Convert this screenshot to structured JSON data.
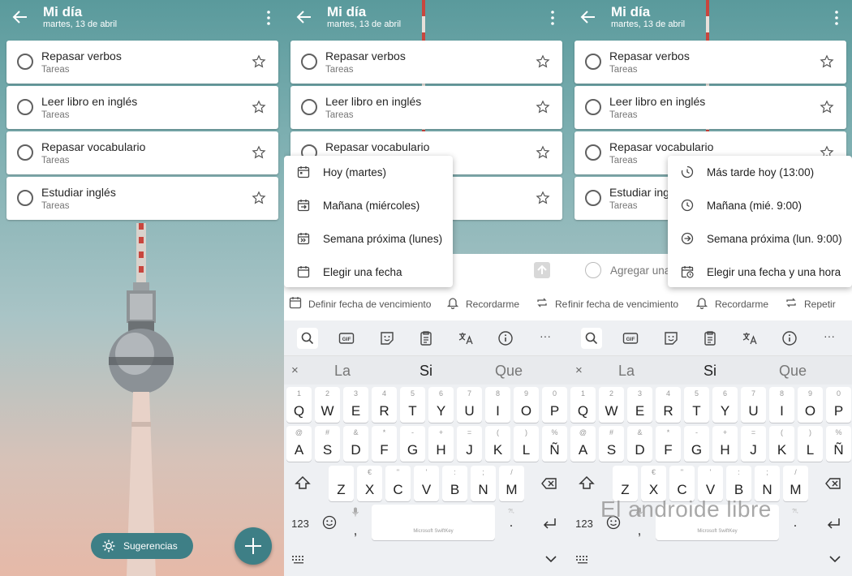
{
  "app": {
    "title": "Mi día",
    "subtitle": "martes, 13 de abril"
  },
  "tasks": [
    {
      "title": "Repasar verbos",
      "list": "Tareas"
    },
    {
      "title": "Leer libro en inglés",
      "list": "Tareas"
    },
    {
      "title": "Repasar vocabulario",
      "list": "Tareas"
    },
    {
      "title": "Estudiar inglés",
      "list": "Tareas"
    }
  ],
  "panel3_task4_visible": "Estudiar ing",
  "suggestions_button": "Sugerencias",
  "add_task_placeholder": "Agregar una",
  "options": {
    "due_date": "Definir fecha de vencimiento",
    "due_date_cut": "finir fecha de vencimiento",
    "repeat_cut": "Re",
    "remind": "Recordarme",
    "repeat": "Repetir"
  },
  "due_menu": [
    {
      "icon": "calendar-today-icon",
      "label": "Hoy (martes)"
    },
    {
      "icon": "calendar-tomorrow-icon",
      "label": "Mañana (miércoles)"
    },
    {
      "icon": "calendar-next-week-icon",
      "label": "Semana próxima (lunes)"
    },
    {
      "icon": "calendar-pick-icon",
      "label": "Elegir una fecha"
    }
  ],
  "remind_menu": [
    {
      "icon": "clock-later-icon",
      "label": "Más tarde hoy (13:00)"
    },
    {
      "icon": "clock-icon",
      "label": "Mañana (mié. 9:00)"
    },
    {
      "icon": "arrow-circle-icon",
      "label": "Semana próxima (lun. 9:00)"
    },
    {
      "icon": "calendar-clock-icon",
      "label": "Elegir una fecha y una hora"
    }
  ],
  "keyboard": {
    "toolbar_icons": [
      "search-icon",
      "gif-icon",
      "sticker-icon",
      "clipboard-icon",
      "translate-icon",
      "info-icon",
      "more-icon"
    ],
    "gif_label": "GIF",
    "more_label": "···",
    "suggestions": [
      "La",
      "Si",
      "Que"
    ],
    "close_label": "×",
    "row1": [
      [
        "Q",
        "1"
      ],
      [
        "W",
        "2"
      ],
      [
        "E",
        "3"
      ],
      [
        "R",
        "4"
      ],
      [
        "T",
        "5"
      ],
      [
        "Y",
        "6"
      ],
      [
        "U",
        "7"
      ],
      [
        "I",
        "8"
      ],
      [
        "O",
        "9"
      ],
      [
        "P",
        "0"
      ]
    ],
    "row2": [
      [
        "A",
        "@"
      ],
      [
        "S",
        "#"
      ],
      [
        "D",
        "&"
      ],
      [
        "F",
        "*"
      ],
      [
        "G",
        "-"
      ],
      [
        "H",
        "+"
      ],
      [
        "J",
        "="
      ],
      [
        "K",
        "("
      ],
      [
        "L",
        ")"
      ],
      [
        "Ñ",
        "%"
      ]
    ],
    "row3": [
      [
        "Z",
        ""
      ],
      [
        "X",
        "€"
      ],
      [
        "C",
        "\""
      ],
      [
        "V",
        "'"
      ],
      [
        "B",
        ":"
      ],
      [
        "N",
        ";"
      ],
      [
        "M",
        "/"
      ]
    ],
    "numbers_key": "123",
    "comma": ",",
    "period": ".",
    "space_brand": "Microsoft SwiftKey",
    "period_sec": "?!,"
  },
  "watermark": "El androide libre",
  "colors": {
    "accent": "#3e7f86",
    "sky_top": "#5a9a9c",
    "sky_bottom": "#e6b9a8"
  }
}
